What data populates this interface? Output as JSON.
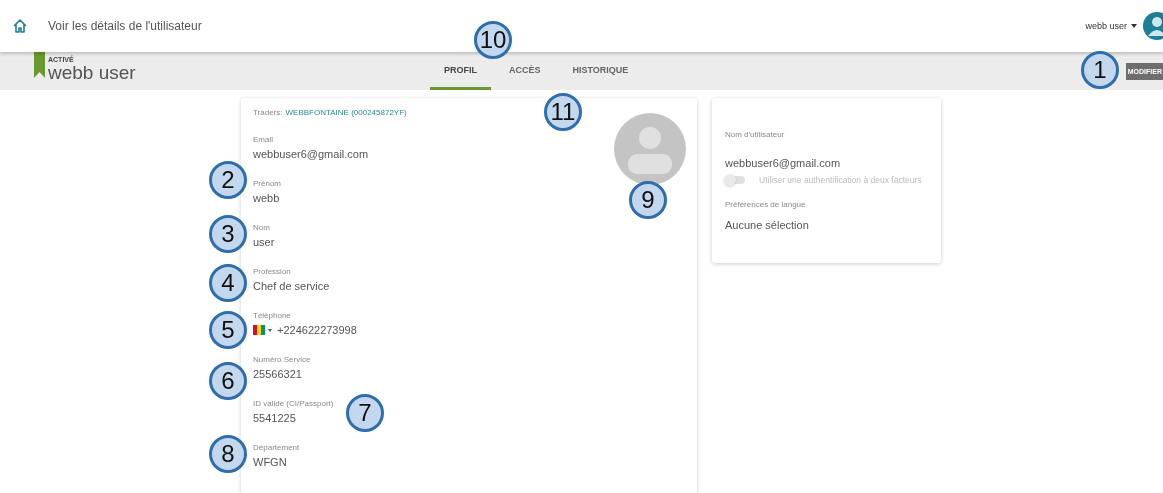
{
  "topbar": {
    "title": "Voir les détails de l'utilisateur",
    "user_menu": "webb user"
  },
  "header": {
    "status": "ACTIVÉ",
    "name": "webb user",
    "action": "MODIFIER"
  },
  "tabs": [
    {
      "label": "PROFIL",
      "selected": true
    },
    {
      "label": "ACCÈS",
      "selected": false
    },
    {
      "label": "HISTORIQUE",
      "selected": false
    }
  ],
  "profile": {
    "traders_label": "Traders:",
    "traders_link": "WEBBFONTAINE (000245872YF)",
    "fields": [
      {
        "kind": "text",
        "label": "Email",
        "value": "webbuser6@gmail.com"
      },
      {
        "kind": "text",
        "label": "Prénom",
        "value": "webb"
      },
      {
        "kind": "text",
        "label": "Nom",
        "value": "user"
      },
      {
        "kind": "text",
        "label": "Profession",
        "value": "Chef de service"
      },
      {
        "kind": "phone",
        "label": "Téléphone",
        "value": "+224622273998"
      },
      {
        "kind": "text",
        "label": "Numéro Service",
        "value": "25566321"
      },
      {
        "kind": "text",
        "label": "ID valide (CI/Passport)",
        "value": "5541225"
      },
      {
        "kind": "text",
        "label": "Département",
        "value": "WFGN"
      }
    ]
  },
  "account": {
    "username_label": "Nom d'utilisateur",
    "username": "webbuser6@gmail.com",
    "two_factor": {
      "label": "Utiliser une authentification à deux facteurs",
      "on": false,
      "disabled": true
    },
    "language_label": "Préférences de langue",
    "language": "Aucune sélection"
  },
  "callouts": [
    {
      "label": "10"
    },
    {
      "label": "1"
    },
    {
      "label": "11"
    },
    {
      "label": "2"
    },
    {
      "label": "3"
    },
    {
      "label": "4"
    },
    {
      "label": "5"
    },
    {
      "label": "6"
    },
    {
      "label": "7"
    },
    {
      "label": "8"
    },
    {
      "label": "9"
    }
  ]
}
